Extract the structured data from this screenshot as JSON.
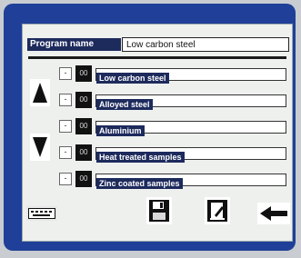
{
  "program": {
    "name_label": "Program name",
    "name_value": "Low carbon steel"
  },
  "rows": [
    {
      "check": "-",
      "number": "00",
      "label": "Low carbon steel"
    },
    {
      "check": "-",
      "number": "00",
      "label": "Alloyed steel"
    },
    {
      "check": "-",
      "number": "00",
      "label": "Aluminium"
    },
    {
      "check": "-",
      "number": "00",
      "label": "Heat treated samples"
    },
    {
      "check": "-",
      "number": "00",
      "label": "Zinc coated samples"
    }
  ],
  "icons": {
    "scroll_up": "arrow-up-icon",
    "scroll_down": "arrow-down-icon",
    "keyboard": "keyboard-icon",
    "save": "floppy-disk-icon",
    "edit": "edit-sheet-icon",
    "back": "arrow-left-icon"
  },
  "colors": {
    "bezel": "#1f3f98",
    "label_bg": "#1d2a5c"
  }
}
